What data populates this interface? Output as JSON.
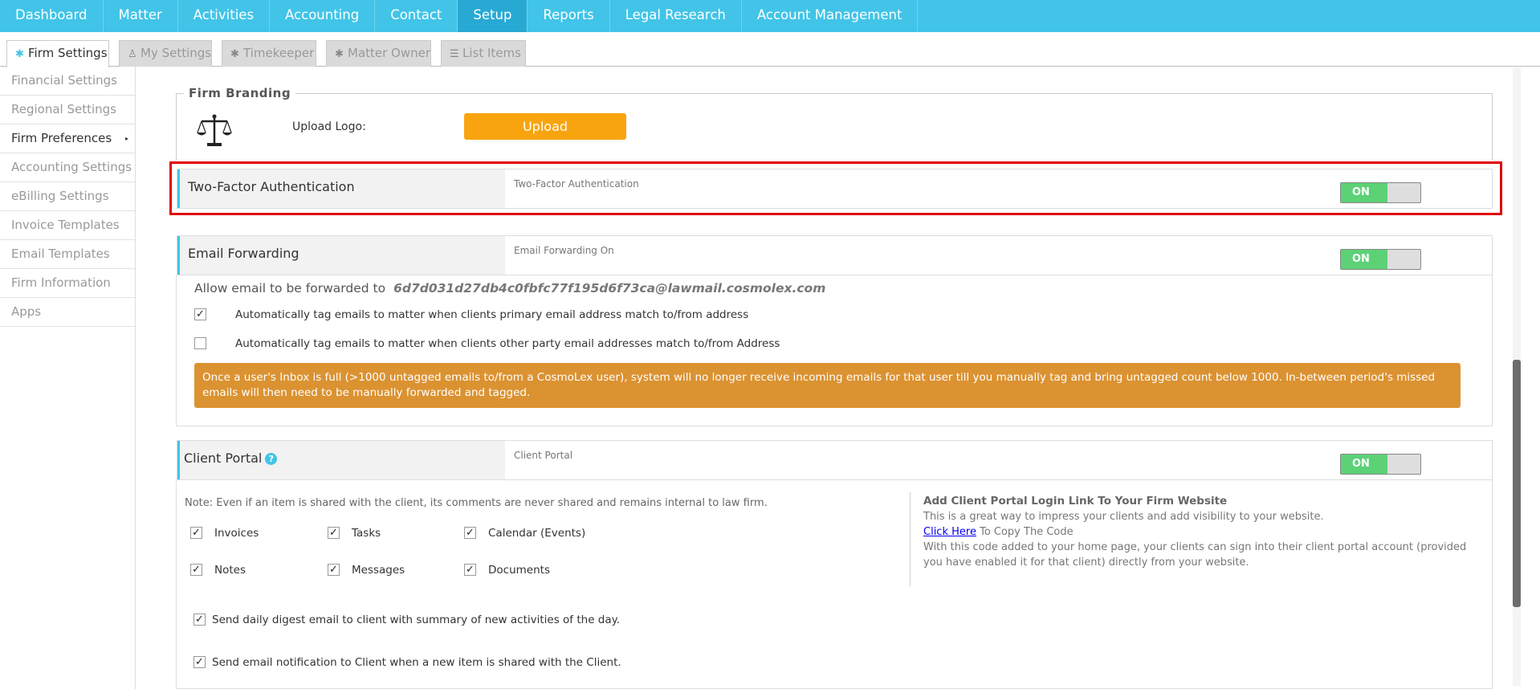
{
  "nav": {
    "items": [
      "Dashboard",
      "Matter",
      "Activities",
      "Accounting",
      "Contact",
      "Setup",
      "Reports",
      "Legal Research",
      "Account Management"
    ]
  },
  "tabs": {
    "firm_settings": "Firm Settings",
    "my_settings": "My Settings",
    "timekeeper": "Timekeeper",
    "matter_owner": "Matter Owner",
    "list_items": "List Items"
  },
  "sidebar": {
    "items": [
      "Financial Settings",
      "Regional Settings",
      "Firm Preferences",
      "Accounting Settings",
      "eBilling Settings",
      "Invoice Templates",
      "Email Templates",
      "Firm Information",
      "Apps"
    ]
  },
  "branding": {
    "legend": "Firm Branding",
    "upload_label": "Upload Logo:",
    "upload_button": "Upload"
  },
  "two_factor": {
    "label": "Two-Factor Authentication",
    "description": "Two-Factor Authentication",
    "toggle": "ON"
  },
  "email_forwarding": {
    "label": "Email Forwarding",
    "description": "Email Forwarding On",
    "toggle": "ON",
    "allow_text": "Allow email to be forwarded to",
    "address": "6d7d031d27db4c0fbfc77f195d6f73ca@lawmail.cosmolex.com",
    "options": [
      {
        "label": "Automatically tag emails to matter when clients primary email address match to/from address",
        "checked": true
      },
      {
        "label": "Automatically tag emails to matter when clients other party email addresses match to/from Address",
        "checked": false
      }
    ],
    "warning": "Once a user's Inbox is full (>1000 untagged emails to/from a CosmoLex user), system will no longer receive incoming emails for that user till you manually tag and bring untagged count below 1000. In-between period's missed emails will then need to be manually forwarded and tagged."
  },
  "client_portal": {
    "label": "Client Portal",
    "help_icon": "?",
    "description": "Client Portal",
    "toggle": "ON",
    "note": "Note: Even if an item is shared with the client, its comments are never shared and remains internal to law firm.",
    "items": [
      {
        "label": "Invoices",
        "checked": true
      },
      {
        "label": "Tasks",
        "checked": true
      },
      {
        "label": "Calendar (Events)",
        "checked": true
      },
      {
        "label": "Notes",
        "checked": true
      },
      {
        "label": "Messages",
        "checked": true
      },
      {
        "label": "Documents",
        "checked": true
      }
    ],
    "digest": "Send daily digest email to client with summary of new activities of the day.",
    "notify": "Send email notification to Client when a new item is shared with the Client.",
    "info_heading": "Add Client Portal Login Link To Your Firm Website",
    "info_line1": "This is a great way to impress your clients and add visibility to your website.",
    "info_link": "Click Here",
    "info_link_suffix": " To Copy The Code",
    "info_line3": "With this code added to your home page, your clients can sign into their client portal account (provided you have enabled it for that client) directly from your website."
  },
  "icons": {
    "checkmark": "✓",
    "gear": "✱",
    "arrow": "▸"
  },
  "colors": {
    "nav": "#41c4e8",
    "upload": "#f8a40f",
    "toggle_on": "#5cd176",
    "warning": "#db9231",
    "highlight": "#e00000"
  }
}
